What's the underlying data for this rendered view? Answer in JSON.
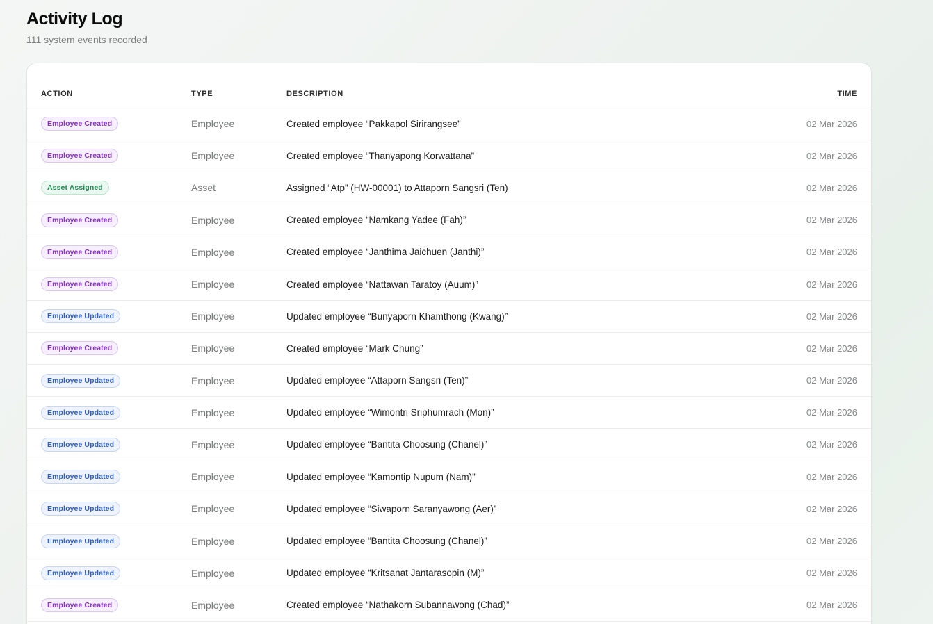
{
  "page": {
    "title": "Activity Log",
    "subtitle": "111 system events recorded"
  },
  "table": {
    "headers": {
      "action": "ACTION",
      "type": "TYPE",
      "description": "DESCRIPTION",
      "time": "TIME"
    },
    "rows": [
      {
        "action": "Employee Created",
        "kind": "created",
        "type": "Employee",
        "description": "Created employee “Pakkapol Sirirangsee”",
        "time": "02 Mar 2026"
      },
      {
        "action": "Employee Created",
        "kind": "created",
        "type": "Employee",
        "description": "Created employee “Thanyapong Korwattana”",
        "time": "02 Mar 2026"
      },
      {
        "action": "Asset Assigned",
        "kind": "assigned",
        "type": "Asset",
        "description": "Assigned “Atp” (HW-00001) to Attaporn Sangsri (Ten)",
        "time": "02 Mar 2026"
      },
      {
        "action": "Employee Created",
        "kind": "created",
        "type": "Employee",
        "description": "Created employee “Namkang Yadee (Fah)”",
        "time": "02 Mar 2026"
      },
      {
        "action": "Employee Created",
        "kind": "created",
        "type": "Employee",
        "description": "Created employee “Janthima Jaichuen (Janthi)”",
        "time": "02 Mar 2026"
      },
      {
        "action": "Employee Created",
        "kind": "created",
        "type": "Employee",
        "description": "Created employee “Nattawan Taratoy (Auum)”",
        "time": "02 Mar 2026"
      },
      {
        "action": "Employee Updated",
        "kind": "updated",
        "type": "Employee",
        "description": "Updated employee “Bunyaporn Khamthong (Kwang)”",
        "time": "02 Mar 2026"
      },
      {
        "action": "Employee Created",
        "kind": "created",
        "type": "Employee",
        "description": "Created employee “Mark Chung”",
        "time": "02 Mar 2026"
      },
      {
        "action": "Employee Updated",
        "kind": "updated",
        "type": "Employee",
        "description": "Updated employee “Attaporn Sangsri (Ten)”",
        "time": "02 Mar 2026"
      },
      {
        "action": "Employee Updated",
        "kind": "updated",
        "type": "Employee",
        "description": "Updated employee “Wimontri Sriphumrach (Mon)”",
        "time": "02 Mar 2026"
      },
      {
        "action": "Employee Updated",
        "kind": "updated",
        "type": "Employee",
        "description": "Updated employee “Bantita Choosung (Chanel)”",
        "time": "02 Mar 2026"
      },
      {
        "action": "Employee Updated",
        "kind": "updated",
        "type": "Employee",
        "description": "Updated employee “Kamontip Nupum (Nam)”",
        "time": "02 Mar 2026"
      },
      {
        "action": "Employee Updated",
        "kind": "updated",
        "type": "Employee",
        "description": "Updated employee “Siwaporn Saranyawong (Aer)”",
        "time": "02 Mar 2026"
      },
      {
        "action": "Employee Updated",
        "kind": "updated",
        "type": "Employee",
        "description": "Updated employee “Bantita Choosung (Chanel)”",
        "time": "02 Mar 2026"
      },
      {
        "action": "Employee Updated",
        "kind": "updated",
        "type": "Employee",
        "description": "Updated employee “Kritsanat Jantarasopin (M)”",
        "time": "02 Mar 2026"
      },
      {
        "action": "Employee Created",
        "kind": "created",
        "type": "Employee",
        "description": "Created employee “Nathakorn Subannawong (Chad)”",
        "time": "02 Mar 2026"
      }
    ]
  },
  "colors": {
    "created_badge": "#8a2fc9",
    "updated_badge": "#2e5fc4",
    "assigned_badge": "#1f8a52"
  }
}
